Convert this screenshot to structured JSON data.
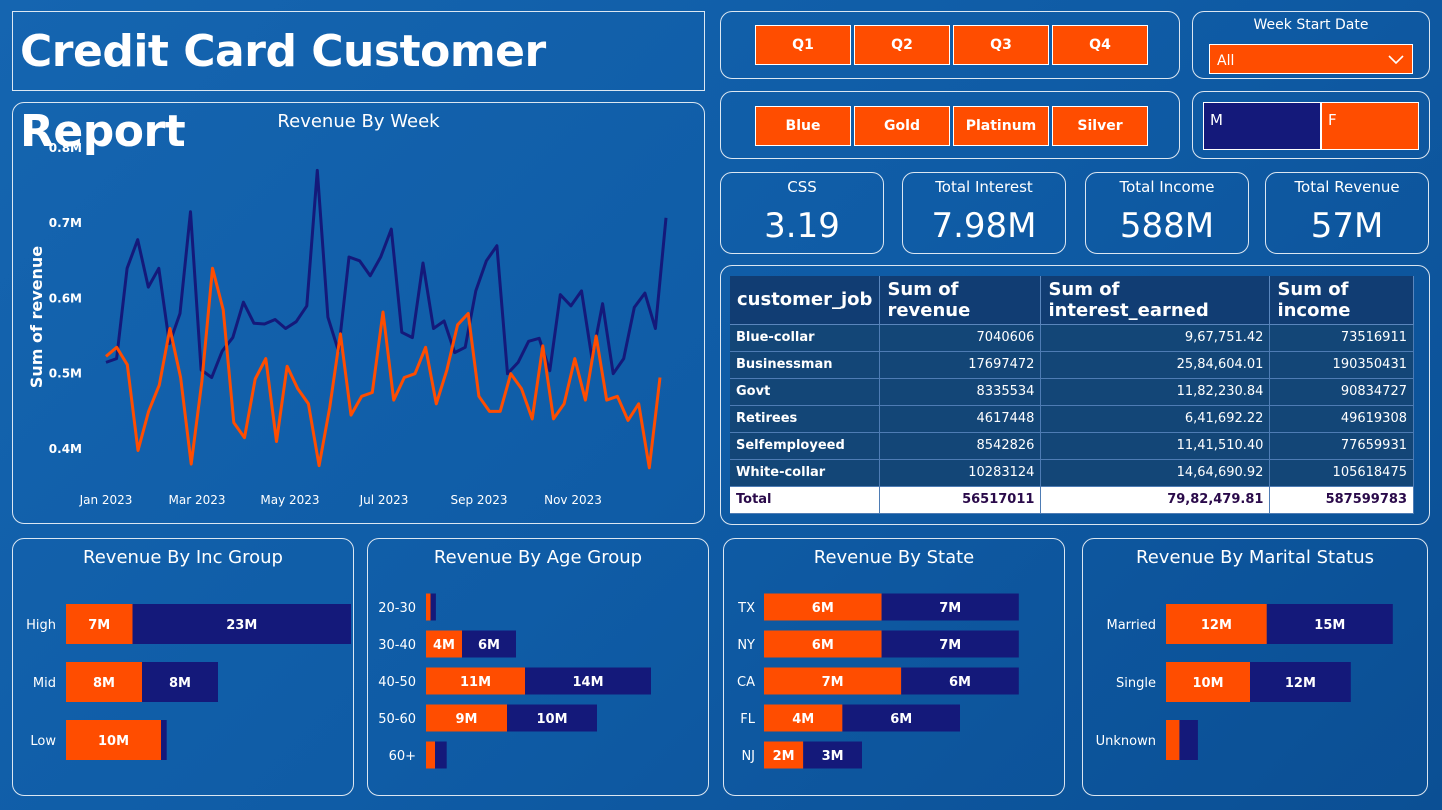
{
  "header": {
    "title": "Credit Card Customer Report"
  },
  "slicers": {
    "quarters": [
      "Q1",
      "Q2",
      "Q3",
      "Q4"
    ],
    "card_categories": [
      "Blue",
      "Gold",
      "Platinum",
      "Silver"
    ],
    "gender": [
      "M",
      "F"
    ],
    "week_start": {
      "label": "Week Start Date",
      "value": "All"
    }
  },
  "kpis": [
    {
      "label": "CSS",
      "value": "3.19"
    },
    {
      "label": "Total Interest",
      "value": "7.98M"
    },
    {
      "label": "Total Income",
      "value": "588M"
    },
    {
      "label": "Total Revenue",
      "value": "57M"
    }
  ],
  "table": {
    "headers": [
      "customer_job",
      "Sum of revenue",
      "Sum of interest_earned",
      "Sum of income"
    ],
    "rows": [
      [
        "Blue-collar",
        "7040606",
        "9,67,751.42",
        "73516911"
      ],
      [
        "Businessman",
        "17697472",
        "25,84,604.01",
        "190350431"
      ],
      [
        "Govt",
        "8335534",
        "11,82,230.84",
        "90834727"
      ],
      [
        "Retirees",
        "4617448",
        "6,41,692.22",
        "49619308"
      ],
      [
        "Selfemployeed",
        "8542826",
        "11,41,510.40",
        "77659931"
      ],
      [
        "White-collar",
        "10283124",
        "14,64,690.92",
        "105618475"
      ]
    ],
    "total": [
      "Total",
      "56517011",
      "79,82,479.81",
      "587599783"
    ]
  },
  "colors": {
    "orange": "#ff4d00",
    "navy": "#14197a",
    "bg": "#0f5ca6"
  },
  "chart_data": [
    {
      "type": "line",
      "title": "Revenue By Week",
      "ylabel": "Sum of revenue",
      "xlabel": "",
      "ylim": [
        0.38,
        0.8
      ],
      "yticks": [
        "0.4M",
        "0.5M",
        "0.6M",
        "0.7M",
        "0.8M"
      ],
      "xticks": [
        "Jan 2023",
        "Mar 2023",
        "May 2023",
        "Jul 2023",
        "Sep 2023",
        "Nov 2023"
      ],
      "series": [
        {
          "color": "#14197a",
          "values": [
            0.515,
            0.52,
            0.64,
            0.678,
            0.615,
            0.64,
            0.54,
            0.58,
            0.715,
            0.505,
            0.495,
            0.53,
            0.548,
            0.595,
            0.567,
            0.566,
            0.572,
            0.56,
            0.569,
            0.59,
            0.77,
            0.575,
            0.53,
            0.655,
            0.65,
            0.63,
            0.655,
            0.692,
            0.555,
            0.548,
            0.647,
            0.56,
            0.57,
            0.528,
            0.535,
            0.61,
            0.65,
            0.67,
            0.5,
            0.515,
            0.543,
            0.547,
            0.504,
            0.605,
            0.59,
            0.61,
            0.52,
            0.593,
            0.5,
            0.52,
            0.588,
            0.607,
            0.56,
            0.707
          ]
        },
        {
          "color": "#ff4d00",
          "values": [
            0.523,
            0.535,
            0.512,
            0.398,
            0.45,
            0.485,
            0.56,
            0.495,
            0.38,
            0.49,
            0.64,
            0.585,
            0.435,
            0.415,
            0.493,
            0.52,
            0.41,
            0.51,
            0.48,
            0.46,
            0.378,
            0.455,
            0.553,
            0.445,
            0.47,
            0.475,
            0.582,
            0.465,
            0.495,
            0.5,
            0.535,
            0.46,
            0.505,
            0.565,
            0.58,
            0.47,
            0.45,
            0.45,
            0.5,
            0.48,
            0.44,
            0.537,
            0.44,
            0.46,
            0.52,
            0.465,
            0.55,
            0.465,
            0.47,
            0.438,
            0.46,
            0.375,
            0.495
          ]
        }
      ]
    },
    {
      "type": "bar",
      "title": "Revenue By Inc Group",
      "categories": [
        "High",
        "Mid",
        "Low"
      ],
      "series": [
        {
          "color": "#ff4d00",
          "values": [
            7,
            8,
            10
          ],
          "labels": [
            "7M",
            "8M",
            "10M"
          ]
        },
        {
          "color": "#14197a",
          "values": [
            23,
            8,
            0.6
          ],
          "labels": [
            "23M",
            "8M",
            ""
          ]
        }
      ],
      "xlim": [
        0,
        30
      ]
    },
    {
      "type": "bar",
      "title": "Revenue By Age Group",
      "categories": [
        "20-30",
        "30-40",
        "40-50",
        "50-60",
        "60+"
      ],
      "series": [
        {
          "color": "#ff4d00",
          "values": [
            0.5,
            4,
            11,
            9,
            1
          ],
          "labels": [
            "",
            "4M",
            "11M",
            "9M",
            ""
          ]
        },
        {
          "color": "#14197a",
          "values": [
            0.6,
            6,
            14,
            10,
            1.3
          ],
          "labels": [
            "",
            "6M",
            "14M",
            "10M",
            ""
          ]
        }
      ],
      "xlim": [
        0,
        25
      ]
    },
    {
      "type": "bar",
      "title": "Revenue By State",
      "categories": [
        "TX",
        "NY",
        "CA",
        "FL",
        "NJ"
      ],
      "series": [
        {
          "color": "#ff4d00",
          "values": [
            6,
            6,
            7,
            4,
            2
          ],
          "labels": [
            "6M",
            "6M",
            "7M",
            "4M",
            "2M"
          ]
        },
        {
          "color": "#14197a",
          "values": [
            7,
            7,
            6,
            6,
            3
          ],
          "labels": [
            "7M",
            "7M",
            "6M",
            "6M",
            "3M"
          ]
        }
      ],
      "xlim": [
        0,
        13
      ]
    },
    {
      "type": "bar",
      "title": "Revenue By Marital Status",
      "categories": [
        "Married",
        "Single",
        "Unknown"
      ],
      "series": [
        {
          "color": "#ff4d00",
          "values": [
            12,
            10,
            1.6
          ],
          "labels": [
            "12M",
            "10M",
            ""
          ]
        },
        {
          "color": "#14197a",
          "values": [
            15,
            12,
            2.2
          ],
          "labels": [
            "15M",
            "12M",
            ""
          ]
        }
      ],
      "xlim": [
        0,
        27
      ]
    }
  ]
}
